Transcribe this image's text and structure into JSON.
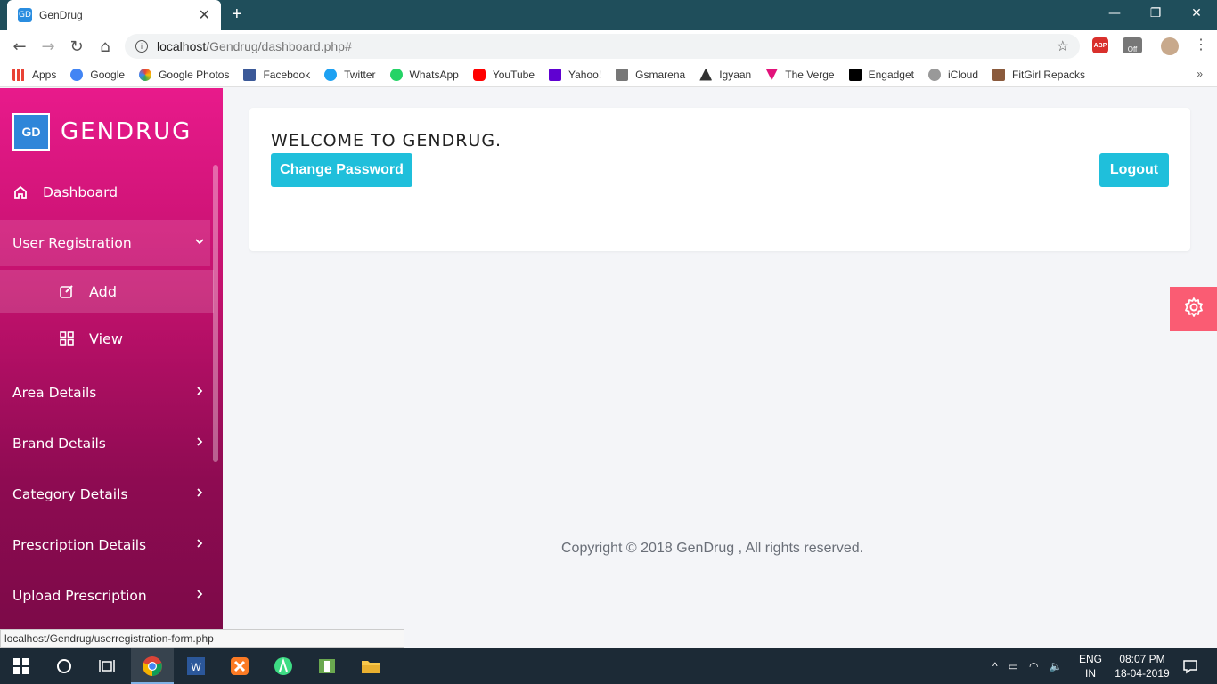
{
  "browser": {
    "tab_title": "GenDrug",
    "url_host": "localhost",
    "url_path": "/Gendrug/dashboard.php#",
    "status_url": "localhost/Gendrug/userregistration-form.php",
    "ext_abp": "ABP",
    "ext_off": "Off",
    "bookmarks": [
      {
        "label": "Apps",
        "color": "#e94235"
      },
      {
        "label": "Google",
        "color": "#4285f4"
      },
      {
        "label": "Google Photos",
        "color": "#fbbc04"
      },
      {
        "label": "Facebook",
        "color": "#3b5998"
      },
      {
        "label": "Twitter",
        "color": "#1da1f2"
      },
      {
        "label": "WhatsApp",
        "color": "#25d366"
      },
      {
        "label": "YouTube",
        "color": "#ff0000"
      },
      {
        "label": "Yahoo!",
        "color": "#5f01d1"
      },
      {
        "label": "Gsmarena",
        "color": "#777777"
      },
      {
        "label": "Igyaan",
        "color": "#333333"
      },
      {
        "label": "The Verge",
        "color": "#e2127a"
      },
      {
        "label": "Engadget",
        "color": "#000000"
      },
      {
        "label": "iCloud",
        "color": "#999999"
      },
      {
        "label": "FitGirl Repacks",
        "color": "#8a5a3c"
      }
    ],
    "bookmarks_more": "»"
  },
  "sidebar": {
    "brand": "GENDRUG",
    "logo_text": "GD",
    "items": [
      {
        "label": "Dashboard",
        "icon": "home-icon"
      },
      {
        "label": "User Registration",
        "icon": "chevron-down-icon"
      },
      {
        "label": "Add",
        "icon": "edit-icon"
      },
      {
        "label": "View",
        "icon": "grid-icon"
      },
      {
        "label": "Area Details",
        "icon": "chevron-right-icon"
      },
      {
        "label": "Brand Details",
        "icon": "chevron-right-icon"
      },
      {
        "label": "Category Details",
        "icon": "chevron-right-icon"
      },
      {
        "label": "Prescription Details",
        "icon": "chevron-right-icon"
      },
      {
        "label": "Upload Prescription",
        "icon": "chevron-right-icon"
      }
    ]
  },
  "main": {
    "welcome": "WELCOME TO GENDRUG.",
    "change_password": "Change Password",
    "logout": "Logout",
    "footer": "Copyright © 2018 GenDrug , All rights reserved."
  },
  "taskbar": {
    "lang1": "ENG",
    "lang2": "IN",
    "time": "08:07 PM",
    "date": "18-04-2019"
  },
  "colors": {
    "accent": "#1fbfdb",
    "sidebar_top": "#e81a8b",
    "gear": "#fa5c73"
  }
}
